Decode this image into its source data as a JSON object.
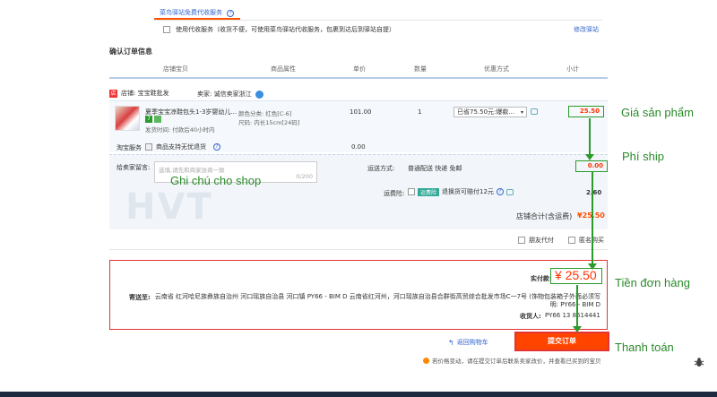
{
  "delivery": {
    "tab_label": "菜鸟驿站免费代收服务",
    "use_service_label": "使用代收服务（收货不便，可使用菜鸟驿站代收服务，包裹到达后到驿站自提）",
    "modify_link": "修改驿站"
  },
  "section_title": "确认订单信息",
  "columns": [
    "店铺宝贝",
    "商品属性",
    "单价",
    "数量",
    "优惠方式",
    "小计"
  ],
  "shop": {
    "name": "店铺: 宝宝鞋批发",
    "seller": "卖家: 诚信卖家浙江"
  },
  "item": {
    "title": "夏季宝宝凉鞋包头1-3岁婴幼儿...",
    "badge_7": "7",
    "ship_time": "发货时间: 付款后40小时内",
    "color": "颜色分类: 红色[C-6]",
    "size": "尺码: 内长15cm[24码]",
    "price": "101.00",
    "qty": "1",
    "discount": "已省75.50元:爆款...",
    "subtotal": "25.50"
  },
  "taobao_service": {
    "label": "淘宝服务",
    "option": "商品支持无忧退货",
    "price": "0.00"
  },
  "message": {
    "label": "给卖家留言:",
    "placeholder": "选填,请先和商家协商一致",
    "counter": "0/200"
  },
  "shipping": {
    "label": "运送方式:",
    "method": "普通配送 快递 免邮",
    "fee": "0.00"
  },
  "insurance": {
    "label": "运费险:",
    "tag": "运费险",
    "text": "退换货可赔付12元",
    "price": "2.60"
  },
  "shop_total": {
    "label": "店铺合计(含运费)",
    "value": "¥25.50"
  },
  "options": {
    "friend_pay": "朋友代付",
    "anonymous": "匿名购买"
  },
  "summary": {
    "paid_label": "实付款:",
    "amount": "¥ 25.50",
    "ship_to_label": "寄送至:",
    "address": "云南省 红河哈尼族彝族自治州 河口瑶族自治县 河口镇 PY66 - BIM D 云南省红河州，河口瑶族自治县合群街高贸综合批发市场C一7号 (饰物包装箱子外面必须写明: PY66 - BIM D",
    "receiver_label": "收货人:",
    "receiver": "PY66 13      8614441"
  },
  "back_link": "返回购物车",
  "submit_label": "提交订单",
  "notice": "若价格变动，请在提交订单后联系卖家改价，并查看已买到的宝贝",
  "annotations": {
    "price": "Giá sản phẩm",
    "ship": "Phí ship",
    "note": "Ghi chú cho shop",
    "total": "Tiền đơn hàng",
    "pay": "Thanh toán"
  },
  "colors": {
    "accent_orange": "#ff5000",
    "annotation_green": "#2a9a2a",
    "highlight_red": "#e33333"
  },
  "icons": [
    "question-icon",
    "shop-icon",
    "chat-icon",
    "left-arrow-icon",
    "warning-icon",
    "bug-icon"
  ]
}
